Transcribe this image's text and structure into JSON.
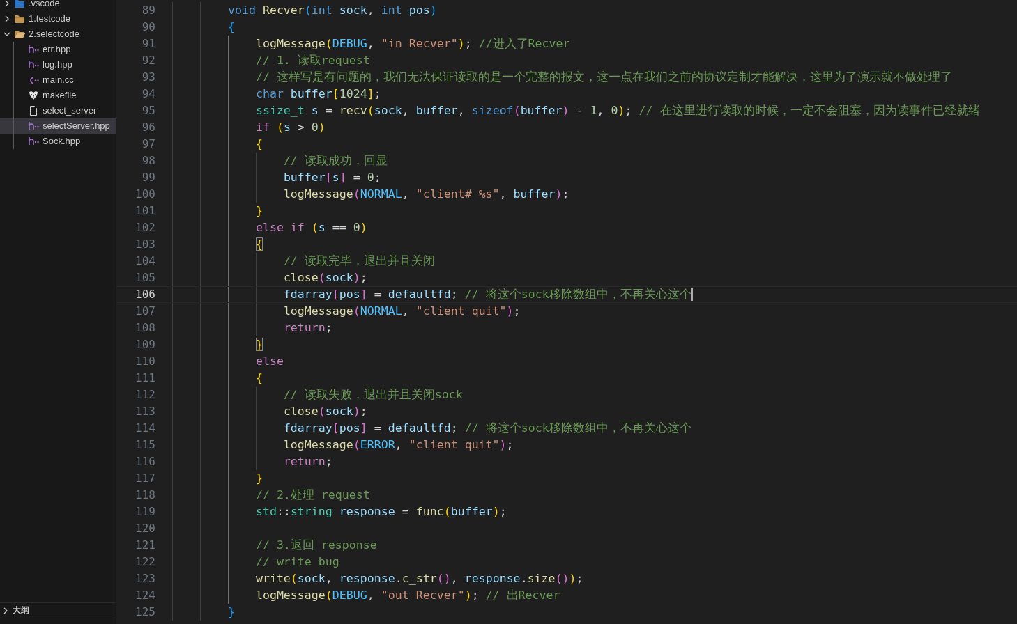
{
  "sidebar": {
    "tree": [
      {
        "label": ".vscode",
        "kind": "vscode-folder",
        "expanded": false,
        "selected": false
      },
      {
        "label": "1.testcode",
        "kind": "folder",
        "expanded": false,
        "selected": false
      },
      {
        "label": "2.selectcode",
        "kind": "folder",
        "expanded": true,
        "selected": false,
        "children": [
          {
            "label": "err.hpp",
            "kind": "header",
            "selected": false
          },
          {
            "label": "log.hpp",
            "kind": "header",
            "selected": false
          },
          {
            "label": "main.cc",
            "kind": "source",
            "selected": false
          },
          {
            "label": "makefile",
            "kind": "makefile",
            "selected": false
          },
          {
            "label": "select_server",
            "kind": "file",
            "selected": false
          },
          {
            "label": "selectServer.hpp",
            "kind": "header",
            "selected": true
          },
          {
            "label": "Sock.hpp",
            "kind": "header",
            "selected": false
          }
        ]
      }
    ],
    "panels": [
      {
        "label": "大纲",
        "expanded": false
      }
    ]
  },
  "editor": {
    "lines": [
      {
        "number": "89",
        "current": false,
        "tokens": [
          {
            "kind": "kw",
            "text": "        void"
          },
          {
            "kind": "fn",
            "text": " Recver"
          },
          {
            "kind": "b3",
            "text": "("
          },
          {
            "kind": "kw",
            "text": "int"
          },
          {
            "kind": "var",
            "text": " sock"
          },
          {
            "kind": "p",
            "text": ", "
          },
          {
            "kind": "kw",
            "text": "int"
          },
          {
            "kind": "var",
            "text": " pos"
          },
          {
            "kind": "b3",
            "text": ")"
          }
        ]
      },
      {
        "number": "90",
        "current": false,
        "tokens": [
          {
            "kind": "b3",
            "text": "        {"
          }
        ]
      },
      {
        "number": "91",
        "current": false,
        "tokens": [
          {
            "kind": "fn",
            "text": "            logMessage"
          },
          {
            "kind": "b1",
            "text": "("
          },
          {
            "kind": "enum",
            "text": "DEBUG"
          },
          {
            "kind": "p",
            "text": ", "
          },
          {
            "kind": "str",
            "text": "\"in Recver\""
          },
          {
            "kind": "b1",
            "text": ")"
          },
          {
            "kind": "p",
            "text": "; "
          },
          {
            "kind": "cmt",
            "text": "//进入了Recver"
          }
        ]
      },
      {
        "number": "92",
        "current": false,
        "tokens": [
          {
            "kind": "cmt",
            "text": "            // 1. 读取request"
          }
        ]
      },
      {
        "number": "93",
        "current": false,
        "tokens": [
          {
            "kind": "cmt",
            "text": "            // 这样写是有问题的，我们无法保证读取的是一个完整的报文，这一点在我们之前的协议定制才能解决，这里为了演示就不做处理了"
          }
        ]
      },
      {
        "number": "94",
        "current": false,
        "tokens": [
          {
            "kind": "kw",
            "text": "            char"
          },
          {
            "kind": "var",
            "text": " buffer"
          },
          {
            "kind": "b1",
            "text": "["
          },
          {
            "kind": "num",
            "text": "1024"
          },
          {
            "kind": "b1",
            "text": "]"
          },
          {
            "kind": "p",
            "text": ";"
          }
        ]
      },
      {
        "number": "95",
        "current": false,
        "tokens": [
          {
            "kind": "type",
            "text": "            ssize_t"
          },
          {
            "kind": "var",
            "text": " s"
          },
          {
            "kind": "p",
            "text": " = "
          },
          {
            "kind": "fn",
            "text": "recv"
          },
          {
            "kind": "b1",
            "text": "("
          },
          {
            "kind": "var",
            "text": "sock"
          },
          {
            "kind": "p",
            "text": ", "
          },
          {
            "kind": "var",
            "text": "buffer"
          },
          {
            "kind": "p",
            "text": ", "
          },
          {
            "kind": "kw",
            "text": "sizeof"
          },
          {
            "kind": "b2",
            "text": "("
          },
          {
            "kind": "var",
            "text": "buffer"
          },
          {
            "kind": "b2",
            "text": ")"
          },
          {
            "kind": "p",
            "text": " - "
          },
          {
            "kind": "num",
            "text": "1"
          },
          {
            "kind": "p",
            "text": ", "
          },
          {
            "kind": "num",
            "text": "0"
          },
          {
            "kind": "b1",
            "text": ")"
          },
          {
            "kind": "p",
            "text": "; "
          },
          {
            "kind": "cmt",
            "text": "// 在这里进行读取的时候，一定不会阻塞，因为读事件已经就绪"
          }
        ]
      },
      {
        "number": "96",
        "current": false,
        "tokens": [
          {
            "kind": "ctl",
            "text": "            if"
          },
          {
            "kind": "b1",
            "text": " ("
          },
          {
            "kind": "var",
            "text": "s"
          },
          {
            "kind": "p",
            "text": " > "
          },
          {
            "kind": "num",
            "text": "0"
          },
          {
            "kind": "b1",
            "text": ")"
          }
        ]
      },
      {
        "number": "97",
        "current": false,
        "tokens": [
          {
            "kind": "b1",
            "text": "            {"
          }
        ]
      },
      {
        "number": "98",
        "current": false,
        "tokens": [
          {
            "kind": "cmt",
            "text": "                // 读取成功，回显"
          }
        ]
      },
      {
        "number": "99",
        "current": false,
        "tokens": [
          {
            "kind": "var",
            "text": "                buffer"
          },
          {
            "kind": "b2",
            "text": "["
          },
          {
            "kind": "var",
            "text": "s"
          },
          {
            "kind": "b2",
            "text": "]"
          },
          {
            "kind": "p",
            "text": " = "
          },
          {
            "kind": "num",
            "text": "0"
          },
          {
            "kind": "p",
            "text": ";"
          }
        ]
      },
      {
        "number": "100",
        "current": false,
        "tokens": [
          {
            "kind": "fn",
            "text": "                logMessage"
          },
          {
            "kind": "b2",
            "text": "("
          },
          {
            "kind": "enum",
            "text": "NORMAL"
          },
          {
            "kind": "p",
            "text": ", "
          },
          {
            "kind": "str",
            "text": "\"client# %s\""
          },
          {
            "kind": "p",
            "text": ", "
          },
          {
            "kind": "var",
            "text": "buffer"
          },
          {
            "kind": "b2",
            "text": ")"
          },
          {
            "kind": "p",
            "text": ";"
          }
        ]
      },
      {
        "number": "101",
        "current": false,
        "tokens": [
          {
            "kind": "b1",
            "text": "            }"
          }
        ]
      },
      {
        "number": "102",
        "current": false,
        "tokens": [
          {
            "kind": "ctl",
            "text": "            else if"
          },
          {
            "kind": "b1",
            "text": " ("
          },
          {
            "kind": "var",
            "text": "s"
          },
          {
            "kind": "p",
            "text": " == "
          },
          {
            "kind": "num",
            "text": "0"
          },
          {
            "kind": "b1",
            "text": ")"
          }
        ]
      },
      {
        "number": "103",
        "current": false,
        "tokens": [
          {
            "kind": "b1-match",
            "text": "            {"
          }
        ]
      },
      {
        "number": "104",
        "current": false,
        "tokens": [
          {
            "kind": "cmt",
            "text": "                // 读取完毕，退出并且关闭"
          }
        ]
      },
      {
        "number": "105",
        "current": false,
        "tokens": [
          {
            "kind": "fn",
            "text": "                close"
          },
          {
            "kind": "b2",
            "text": "("
          },
          {
            "kind": "var",
            "text": "sock"
          },
          {
            "kind": "b2",
            "text": ")"
          },
          {
            "kind": "p",
            "text": ";"
          }
        ]
      },
      {
        "number": "106",
        "current": true,
        "tokens": [
          {
            "kind": "var",
            "text": "                fdarray"
          },
          {
            "kind": "b2",
            "text": "["
          },
          {
            "kind": "var",
            "text": "pos"
          },
          {
            "kind": "b2",
            "text": "]"
          },
          {
            "kind": "p",
            "text": " = "
          },
          {
            "kind": "var",
            "text": "defaultfd"
          },
          {
            "kind": "p",
            "text": "; "
          },
          {
            "kind": "cmt",
            "text": "// 将这个sock移除数组中，不再关心这个"
          }
        ]
      },
      {
        "number": "107",
        "current": false,
        "tokens": [
          {
            "kind": "fn",
            "text": "                logMessage"
          },
          {
            "kind": "b2",
            "text": "("
          },
          {
            "kind": "enum",
            "text": "NORMAL"
          },
          {
            "kind": "p",
            "text": ", "
          },
          {
            "kind": "str",
            "text": "\"client quit\""
          },
          {
            "kind": "b2",
            "text": ")"
          },
          {
            "kind": "p",
            "text": ";"
          }
        ]
      },
      {
        "number": "108",
        "current": false,
        "tokens": [
          {
            "kind": "ctl",
            "text": "                return"
          },
          {
            "kind": "p",
            "text": ";"
          }
        ]
      },
      {
        "number": "109",
        "current": false,
        "tokens": [
          {
            "kind": "b1-match",
            "text": "            }"
          }
        ]
      },
      {
        "number": "110",
        "current": false,
        "tokens": [
          {
            "kind": "ctl",
            "text": "            else"
          }
        ]
      },
      {
        "number": "111",
        "current": false,
        "tokens": [
          {
            "kind": "b1",
            "text": "            {"
          }
        ]
      },
      {
        "number": "112",
        "current": false,
        "tokens": [
          {
            "kind": "cmt",
            "text": "                // 读取失败，退出并且关闭sock"
          }
        ]
      },
      {
        "number": "113",
        "current": false,
        "tokens": [
          {
            "kind": "fn",
            "text": "                close"
          },
          {
            "kind": "b2",
            "text": "("
          },
          {
            "kind": "var",
            "text": "sock"
          },
          {
            "kind": "b2",
            "text": ")"
          },
          {
            "kind": "p",
            "text": ";"
          }
        ]
      },
      {
        "number": "114",
        "current": false,
        "tokens": [
          {
            "kind": "var",
            "text": "                fdarray"
          },
          {
            "kind": "b2",
            "text": "["
          },
          {
            "kind": "var",
            "text": "pos"
          },
          {
            "kind": "b2",
            "text": "]"
          },
          {
            "kind": "p",
            "text": " = "
          },
          {
            "kind": "var",
            "text": "defaultfd"
          },
          {
            "kind": "p",
            "text": "; "
          },
          {
            "kind": "cmt",
            "text": "// 将这个sock移除数组中，不再关心这个"
          }
        ]
      },
      {
        "number": "115",
        "current": false,
        "tokens": [
          {
            "kind": "fn",
            "text": "                logMessage"
          },
          {
            "kind": "b2",
            "text": "("
          },
          {
            "kind": "enum",
            "text": "ERROR"
          },
          {
            "kind": "p",
            "text": ", "
          },
          {
            "kind": "str",
            "text": "\"client quit\""
          },
          {
            "kind": "b2",
            "text": ")"
          },
          {
            "kind": "p",
            "text": ";"
          }
        ]
      },
      {
        "number": "116",
        "current": false,
        "tokens": [
          {
            "kind": "ctl",
            "text": "                return"
          },
          {
            "kind": "p",
            "text": ";"
          }
        ]
      },
      {
        "number": "117",
        "current": false,
        "tokens": [
          {
            "kind": "b1",
            "text": "            }"
          }
        ]
      },
      {
        "number": "118",
        "current": false,
        "tokens": [
          {
            "kind": "cmt",
            "text": "            // 2.处理 request"
          }
        ]
      },
      {
        "number": "119",
        "current": false,
        "tokens": [
          {
            "kind": "type",
            "text": "            std"
          },
          {
            "kind": "p",
            "text": "::"
          },
          {
            "kind": "type",
            "text": "string"
          },
          {
            "kind": "var",
            "text": " response"
          },
          {
            "kind": "p",
            "text": " = "
          },
          {
            "kind": "fn",
            "text": "func"
          },
          {
            "kind": "b1",
            "text": "("
          },
          {
            "kind": "var",
            "text": "buffer"
          },
          {
            "kind": "b1",
            "text": ")"
          },
          {
            "kind": "p",
            "text": ";"
          }
        ]
      },
      {
        "number": "120",
        "current": false
      },
      {
        "number": "121",
        "current": false,
        "tokens": [
          {
            "kind": "cmt",
            "text": "            // 3.返回 response"
          }
        ]
      },
      {
        "number": "122",
        "current": false,
        "tokens": [
          {
            "kind": "cmt",
            "text": "            // write bug"
          }
        ]
      },
      {
        "number": "123",
        "current": false,
        "tokens": [
          {
            "kind": "fn",
            "text": "            write"
          },
          {
            "kind": "b1",
            "text": "("
          },
          {
            "kind": "var",
            "text": "sock"
          },
          {
            "kind": "p",
            "text": ", "
          },
          {
            "kind": "var",
            "text": "response"
          },
          {
            "kind": "p",
            "text": "."
          },
          {
            "kind": "fn",
            "text": "c_str"
          },
          {
            "kind": "b2",
            "text": "("
          },
          {
            "kind": "b2",
            "text": ")"
          },
          {
            "kind": "p",
            "text": ", "
          },
          {
            "kind": "var",
            "text": "response"
          },
          {
            "kind": "p",
            "text": "."
          },
          {
            "kind": "fn",
            "text": "size"
          },
          {
            "kind": "b2",
            "text": "("
          },
          {
            "kind": "b2",
            "text": ")"
          },
          {
            "kind": "b1",
            "text": ")"
          },
          {
            "kind": "p",
            "text": ";"
          }
        ]
      },
      {
        "number": "124",
        "current": false,
        "tokens": [
          {
            "kind": "fn",
            "text": "            logMessage"
          },
          {
            "kind": "b1",
            "text": "("
          },
          {
            "kind": "enum",
            "text": "DEBUG"
          },
          {
            "kind": "p",
            "text": ", "
          },
          {
            "kind": "str",
            "text": "\"out Recver\""
          },
          {
            "kind": "b1",
            "text": ")"
          },
          {
            "kind": "p",
            "text": "; "
          },
          {
            "kind": "cmt",
            "text": "// 出Recver"
          }
        ]
      },
      {
        "number": "125",
        "current": false,
        "tokens": [
          {
            "kind": "b3",
            "text": "        }"
          }
        ]
      }
    ]
  }
}
